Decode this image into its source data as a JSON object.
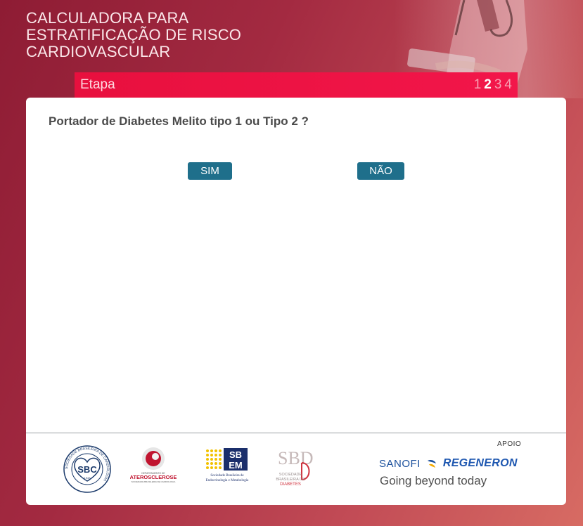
{
  "header": {
    "title_lines": [
      "CALCULADORA PARA",
      "ESTRATIFICAÇÃO DE RISCO",
      "CARDIOVASCULAR"
    ]
  },
  "step_bar": {
    "label": "Etapa",
    "steps": [
      "1",
      "2",
      "3",
      "4"
    ],
    "current_step": 2
  },
  "question": {
    "text": "Portador de Diabetes Melito tipo 1 ou Tipo 2 ?",
    "options": [
      "SIM",
      "NÃO"
    ]
  },
  "footer": {
    "logos": {
      "sbc": {
        "ring_text": "SOCIEDADE BRASILEIRA DE CARDIOLOGIA",
        "center": "SBC",
        "year": "1943"
      },
      "aterosclerose": {
        "top": "DEPARTAMENTO DE",
        "name": "ATEROSCLEROSE",
        "sub": "SOCIEDADE BRASILEIRA DE CARDIOLOGIA"
      },
      "sbem": {
        "mark_top": "SB",
        "mark_bottom": "EM",
        "line1": "Sociedade Brasileira de",
        "line2": "Endocrinologia e Metabologia"
      },
      "sbd": {
        "mark": "SBD",
        "line1": "SOCIEDADE",
        "line2": "BRASILEIRA DE",
        "line3": "DIABETES"
      }
    },
    "apoio_label": "APOIO",
    "sponsor1": "SANOFI",
    "sponsor2": "REGENERON",
    "tagline": "Going beyond today"
  },
  "colors": {
    "background": "#a32a41",
    "step_bar": "#ef1445",
    "button": "#1f6f8b",
    "card": "#ffffff"
  }
}
